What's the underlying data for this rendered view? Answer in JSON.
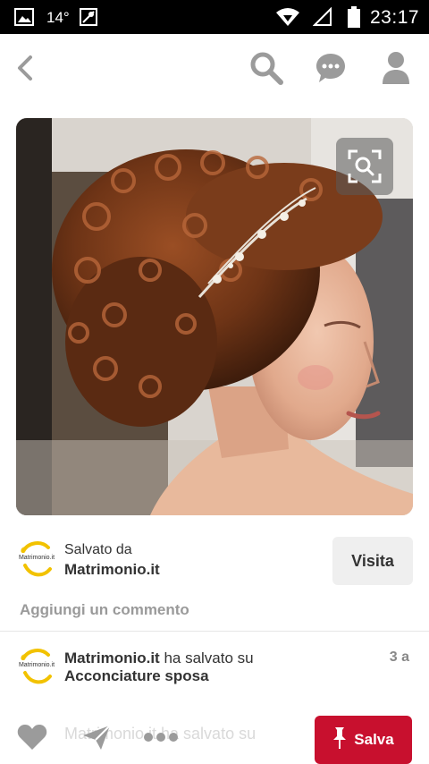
{
  "status_bar": {
    "temperature": "14°",
    "time": "23:17",
    "icons": [
      "image-icon",
      "maps-icon",
      "wifi-icon",
      "signal-icon",
      "battery-icon"
    ]
  },
  "nav": {
    "icons": [
      "back-arrow-icon",
      "search-icon",
      "chat-bubble-icon",
      "profile-icon"
    ]
  },
  "pin": {
    "zoom_icon": "visual-search-icon"
  },
  "source": {
    "saved_label": "Salvato da",
    "name": "Matrimonio.it",
    "logo_text": "Matrimonio.it",
    "visit_label": "Visita"
  },
  "comment": {
    "placeholder": "Aggiungi un commento"
  },
  "activity": {
    "user": "Matrimonio.it",
    "action": " ha salvato su",
    "board": "Acconciature sposa",
    "time": "3 a"
  },
  "bottom": {
    "faded_text": "Matrimonio.it ha salvato su",
    "save_label": "Salva",
    "icons": [
      "heart-icon",
      "send-icon",
      "more-icon",
      "pin-icon"
    ]
  },
  "colors": {
    "accent": "#c8102e",
    "logo_yellow": "#f2c200"
  }
}
